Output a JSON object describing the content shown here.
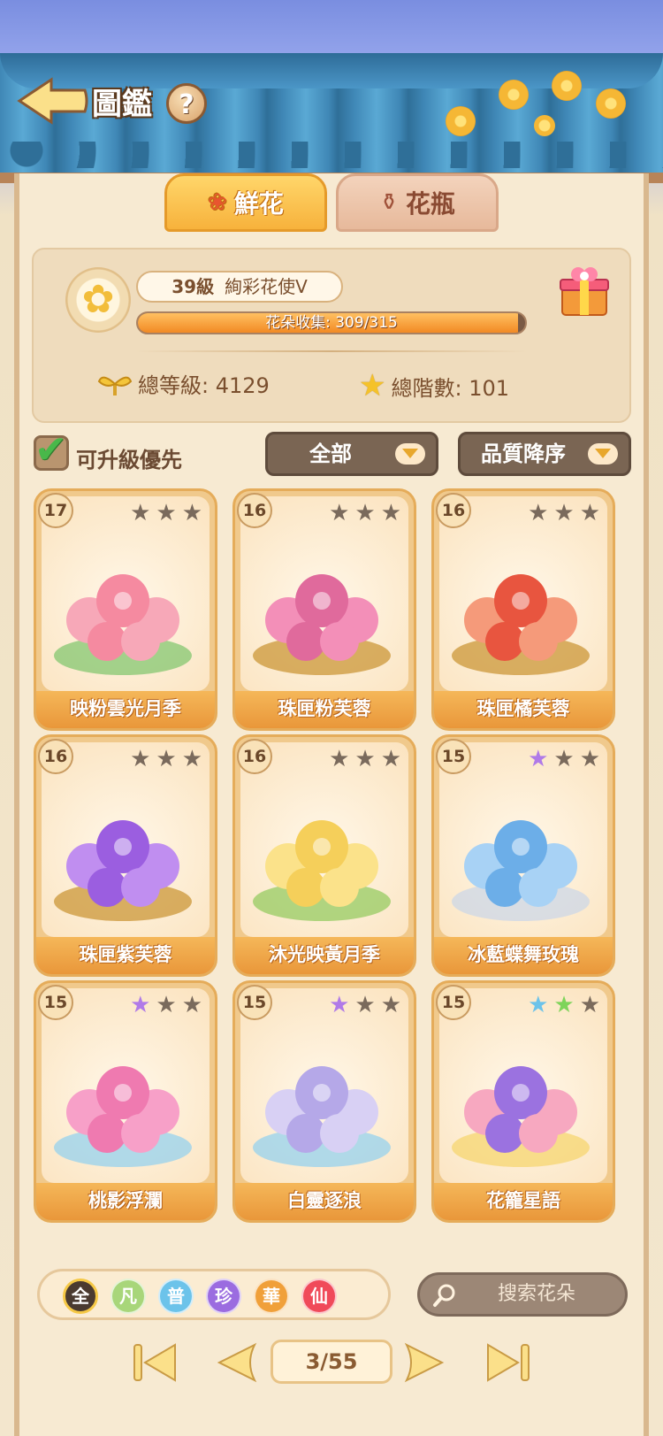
{
  "header": {
    "title": "圖鑑",
    "help_symbol": "?"
  },
  "tabs": [
    {
      "label": "鮮花",
      "icon": "rose-icon",
      "active": true
    },
    {
      "label": "花瓶",
      "icon": "vase-icon",
      "active": false
    }
  ],
  "profile": {
    "level": "39級",
    "rank_title": "絢彩花使V",
    "collection_label": "花朵收集: 309/315",
    "collection_progress": 0.981,
    "total_level_label": "總等級: 4129",
    "total_tier_label": "總階數: 101"
  },
  "filters": {
    "upgradable_first_label": "可升級優先",
    "upgradable_first_checked": true,
    "category_value": "全部",
    "sort_value": "品質降序"
  },
  "cards": [
    {
      "level": "17",
      "name": "映粉雲光月季",
      "stars": [
        "gray",
        "gray",
        "gray"
      ]
    },
    {
      "level": "16",
      "name": "珠匣粉芙蓉",
      "stars": [
        "gray",
        "gray",
        "gray"
      ]
    },
    {
      "level": "16",
      "name": "珠匣橘芙蓉",
      "stars": [
        "gray",
        "gray",
        "gray"
      ]
    },
    {
      "level": "16",
      "name": "珠匣紫芙蓉",
      "stars": [
        "gray",
        "gray",
        "gray"
      ]
    },
    {
      "level": "16",
      "name": "沐光映黃月季",
      "stars": [
        "gray",
        "gray",
        "gray"
      ]
    },
    {
      "level": "15",
      "name": "冰藍蝶舞玫瑰",
      "stars": [
        "purple",
        "gray",
        "gray"
      ]
    },
    {
      "level": "15",
      "name": "桃影浮瀾",
      "stars": [
        "purple",
        "gray",
        "gray"
      ]
    },
    {
      "level": "15",
      "name": "白靈逐浪",
      "stars": [
        "purple",
        "gray",
        "gray"
      ]
    },
    {
      "level": "15",
      "name": "花籠星語",
      "stars": [
        "blue",
        "green",
        "gray"
      ]
    }
  ],
  "quality_filters": [
    {
      "label": "全",
      "color": "#4a3a30"
    },
    {
      "label": "凡",
      "color": "#a8d67a"
    },
    {
      "label": "普",
      "color": "#6cc3ea"
    },
    {
      "label": "珍",
      "color": "#9b6ce0"
    },
    {
      "label": "華",
      "color": "#f0a03a"
    },
    {
      "label": "仙",
      "color": "#f04a5a"
    }
  ],
  "search": {
    "placeholder": "搜索花朵"
  },
  "pagination": {
    "current": "3/55"
  },
  "colors": {
    "star_gray": "#7a6a5c",
    "star_purple": "#b07ae8",
    "star_blue": "#6cc3ea",
    "star_green": "#7ed45a"
  }
}
